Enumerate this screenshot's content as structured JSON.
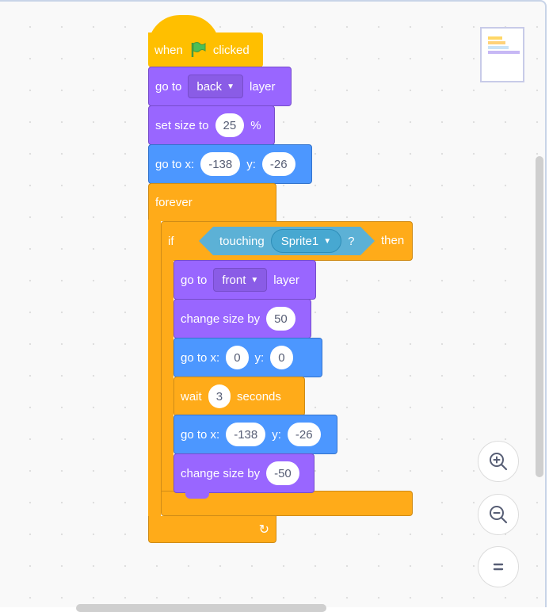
{
  "script": {
    "hat": {
      "before": "when",
      "icon": "green-flag-icon",
      "after": "clicked"
    },
    "go_back_layer": {
      "label": "go to",
      "option": "back",
      "suffix": "layer"
    },
    "set_size": {
      "label": "set size to",
      "value": "25",
      "suffix": "%"
    },
    "goto_xy_1": {
      "label": "go to x:",
      "x": "-138",
      "ylabel": "y:",
      "y": "-26"
    },
    "forever": {
      "label": "forever"
    },
    "if_block": {
      "label": "if",
      "condition": {
        "label": "touching",
        "option": "Sprite1",
        "suffix": "?"
      },
      "then": "then"
    },
    "go_front_layer": {
      "label": "go to",
      "option": "front",
      "suffix": "layer"
    },
    "change_size_1": {
      "label": "change size by",
      "value": "50"
    },
    "goto_xy_2": {
      "label": "go to x:",
      "x": "0",
      "ylabel": "y:",
      "y": "0"
    },
    "wait": {
      "label": "wait",
      "value": "3",
      "suffix": "seconds"
    },
    "goto_xy_3": {
      "label": "go to x:",
      "x": "-138",
      "ylabel": "y:",
      "y": "-26"
    },
    "change_size_2": {
      "label": "change size by",
      "value": "-50"
    }
  },
  "controls": {
    "zoom_in": "zoom-in-icon",
    "zoom_out": "zoom-out-icon",
    "reset": "reset-zoom-icon"
  },
  "colors": {
    "events": "#ffbf00",
    "looks": "#9966ff",
    "motion": "#4c97ff",
    "control": "#ffab19",
    "sensing": "#5cb1d6"
  }
}
